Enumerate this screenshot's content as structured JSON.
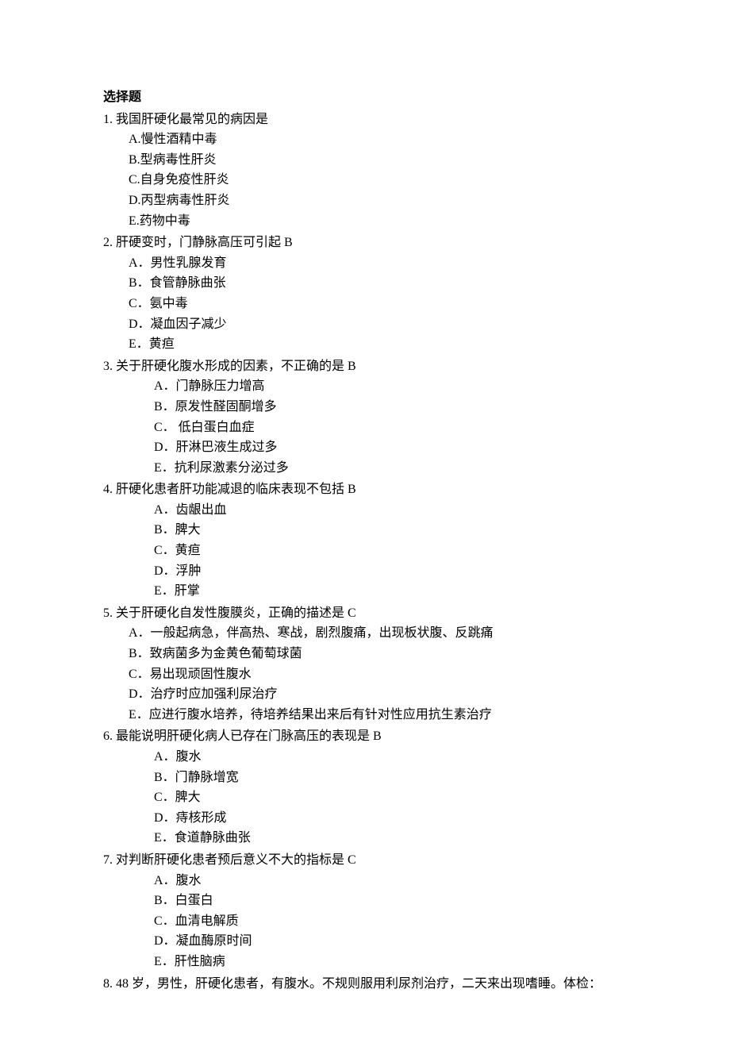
{
  "section_title": "选择题",
  "questions": [
    {
      "num": "1.",
      "stem": "我国肝硬化最常见的病因是",
      "deep": false,
      "options": [
        "A.慢性酒精中毒",
        "B.型病毒性肝炎",
        "C.自身免疫性肝炎",
        "D.丙型病毒性肝炎",
        "E.药物中毒"
      ]
    },
    {
      "num": "2.",
      "stem": "肝硬变时，门静脉高压可引起 B",
      "deep": false,
      "options": [
        "A．男性乳腺发育",
        "B．食管静脉曲张",
        "C．氨中毒",
        "D．凝血因子减少",
        "E．黄疸"
      ]
    },
    {
      "num": "3.",
      "stem": "关于肝硬化腹水形成的因素，不正确的是 B",
      "deep": true,
      "options": [
        "A．门静脉压力增高",
        "B．原发性醛固酮增多",
        "C． 低白蛋白血症",
        "D．肝淋巴液生成过多",
        "E．抗利尿激素分泌过多"
      ]
    },
    {
      "num": "4.",
      "stem": "肝硬化患者肝功能减退的临床表现不包括 B",
      "deep": true,
      "options": [
        "A．齿龈出血",
        "B．脾大",
        "C．黄疸",
        "D．浮肿",
        "E．肝掌"
      ]
    },
    {
      "num": "5.",
      "stem": "关于肝硬化自发性腹膜炎，正确的描述是 C",
      "deep": false,
      "options": [
        "A．一般起病急，伴高热、寒战，剧烈腹痛，出现板状腹、反跳痛",
        "B．致病菌多为金黄色葡萄球菌",
        "C．易出现顽固性腹水",
        "D．治疗时应加强利尿治疗",
        "E．应进行腹水培养，待培养结果出来后有针对性应用抗生素治疗"
      ]
    },
    {
      "num": "6.",
      "stem": "最能说明肝硬化病人已存在门脉高压的表现是 B",
      "deep": true,
      "options": [
        "A．腹水",
        "B．门静脉增宽",
        "C．脾大",
        "D．痔核形成",
        "E．食道静脉曲张"
      ]
    },
    {
      "num": "7.",
      "stem": "对判断肝硬化患者预后意义不大的指标是 C",
      "deep": true,
      "options": [
        "A．腹水",
        "B．白蛋白",
        "C．血清电解质",
        "D．凝血酶原时间",
        "E．肝性脑病"
      ]
    },
    {
      "num": "8.",
      "stem": "48 岁，男性，肝硬化患者，有腹水。不规则服用利尿剂治疗，二天来出现嗜睡。体检：",
      "deep": false,
      "options": []
    }
  ]
}
